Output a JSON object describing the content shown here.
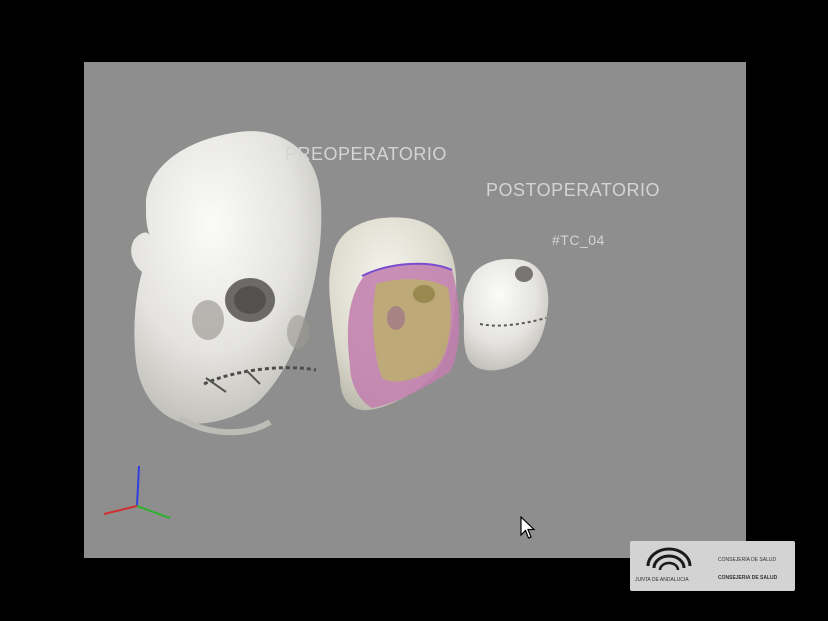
{
  "viewer": {
    "label_preoperative": "PREOPERATORIO",
    "label_postoperative": "POSTOPERATORIO",
    "label_case": "#TC_04",
    "background_color": "#8e8e8e"
  },
  "logo": {
    "org_line_1": "JUNTA DE ANDALUCIA",
    "org_line_2": "CONSEJERÍA DE SALUD",
    "org_line_3": "CONSEJERIA DE SALUD"
  },
  "icons": {
    "axes": "axes-triad-icon",
    "cursor": "mouse-cursor-icon",
    "logo": "junta-andalucia-logo-icon"
  }
}
